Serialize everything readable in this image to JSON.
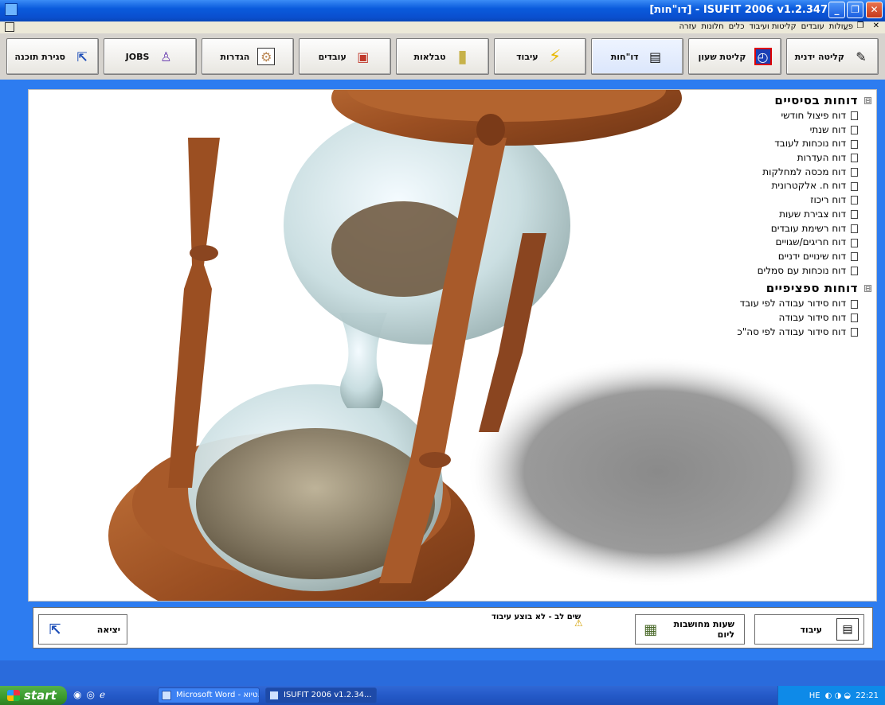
{
  "window": {
    "title": "[דו\"חות] - ISUFIT 2006  v1.2.347",
    "min_label": "_",
    "max_label": "❐",
    "close_label": "✕"
  },
  "menu": {
    "items": [
      "פעולות",
      "עובדים",
      "קליטות ועיבוד",
      "כלים",
      "חלונות",
      "עזרה"
    ],
    "mdi_controls": "_ ❐ ✕"
  },
  "toolbar": {
    "buttons": [
      {
        "label": "קליטה ידנית",
        "icon": "pencil-icon",
        "glyph": "✎"
      },
      {
        "label": "קליטת שעון",
        "icon": "clock-icon",
        "glyph": "◴"
      },
      {
        "label": "דו\"חות",
        "icon": "report-icon",
        "glyph": "▤"
      },
      {
        "label": "עיבוד",
        "icon": "lightning-icon",
        "glyph": "⚡"
      },
      {
        "label": "טבלאות",
        "icon": "folder-icon",
        "glyph": "▮"
      },
      {
        "label": "עובדים",
        "icon": "book-icon",
        "glyph": "▣"
      },
      {
        "label": "הגדרות",
        "icon": "settings-icon",
        "glyph": "⚙"
      },
      {
        "label": "JOBS",
        "icon": "person-icon",
        "glyph": "♙"
      },
      {
        "label": "סגירת תוכנה",
        "icon": "exit-icon",
        "glyph": "⇱"
      }
    ]
  },
  "reports": {
    "basic": {
      "title": "דוחות בסיסיים",
      "toggle": "⊟",
      "items": [
        "דוח פיצול חודשי",
        "דוח שנתי",
        "דוח נוכחות לעובד",
        "דוח העדרות",
        "דוח מכסה למחלקות",
        "דוח ח. אלקטרונית",
        "דוח ריכוז",
        "דוח צבירת שעות",
        "דוח רשימת עובדים",
        "דוח חריגים/שגויים",
        "דוח שינויים ידניים",
        "דוח נוכחות עם סמלים"
      ]
    },
    "specific": {
      "title": "דוחות ספציפיים",
      "toggle": "⊟",
      "items": [
        "דוח סידור עבודה לפי עובד",
        "דוח סידור עבודה",
        "דוח סידור עבודה לפי סה\"כ"
      ]
    }
  },
  "bottom": {
    "process_label": "עיבוד",
    "computed_hours_label": "שעות מחושבות ליום",
    "warning_text": "שים לב - לא בוצע עיבוד",
    "exit_label": "יציאה"
  },
  "taskbar": {
    "start_label": "start",
    "tasks": [
      "Microsoft Word - טיוא...",
      "ISUFIT 2006  v1.2.34..."
    ],
    "tray_lang": "HE",
    "tray_time": "22:21"
  }
}
